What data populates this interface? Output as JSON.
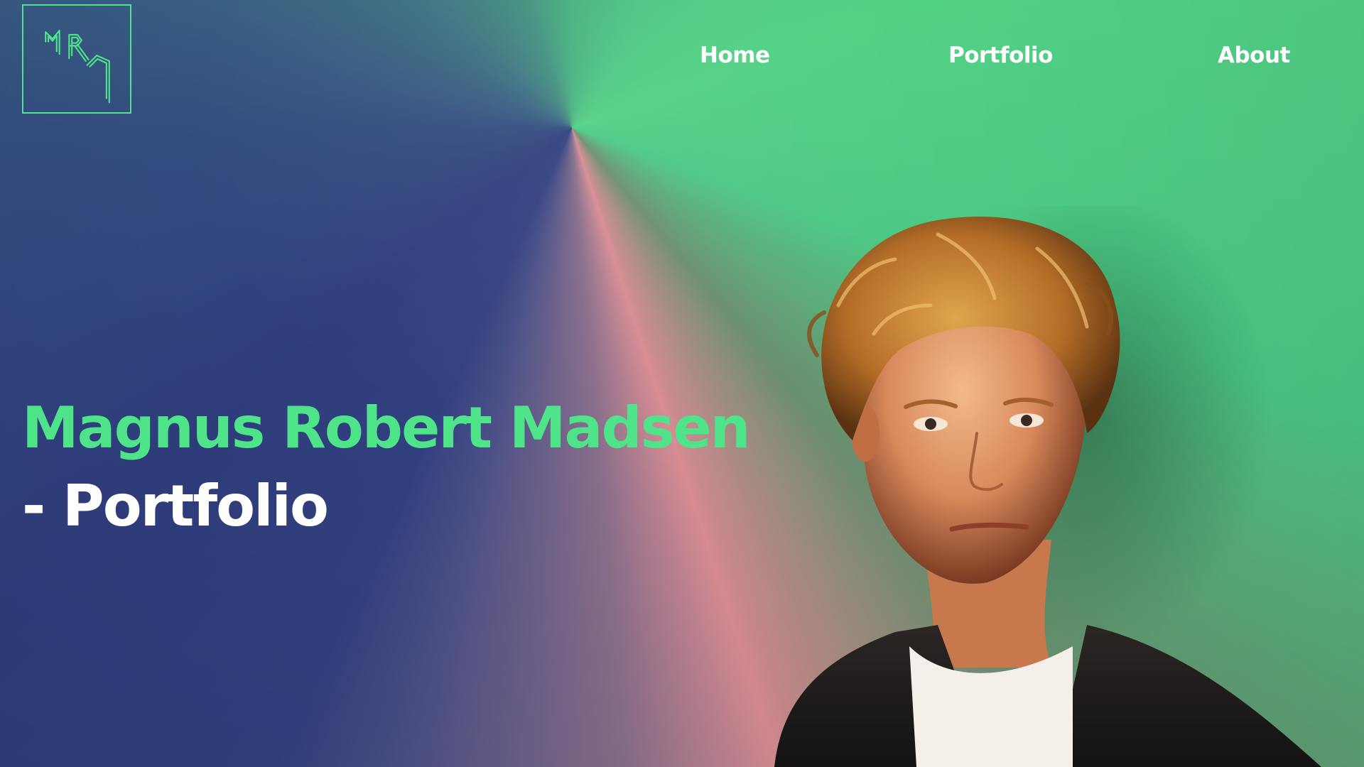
{
  "logo": {
    "icon": "mrm-monogram-logo",
    "color": "#4fe48a"
  },
  "nav": {
    "items": [
      {
        "label": "Home"
      },
      {
        "label": "Portfolio"
      },
      {
        "label": "About"
      }
    ]
  },
  "hero": {
    "title_name": "Magnus Robert Madsen",
    "title_suffix": "- Portfolio",
    "accent_color": "#4fe48a",
    "portrait_icon": "portrait-photo"
  }
}
